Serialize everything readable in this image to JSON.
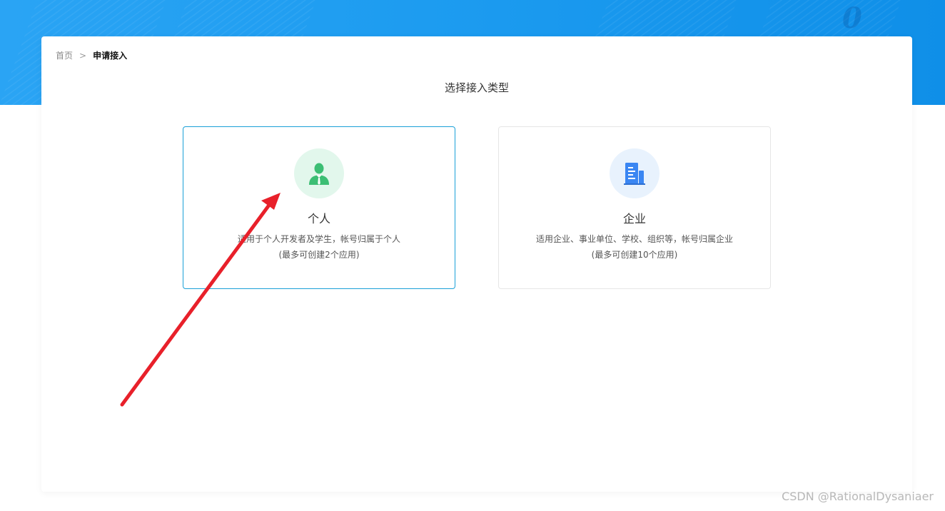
{
  "breadcrumb": {
    "home": "首页",
    "separator": ">",
    "current": "申请接入"
  },
  "page_title": "选择接入类型",
  "access_types": [
    {
      "name": "个人",
      "description": "适用于个人开发者及学生，帐号归属于个人",
      "limit": "(最多可创建2个应用)",
      "icon": "person-icon",
      "selected": true
    },
    {
      "name": "企业",
      "description": "适用企业、事业单位、学校、组织等，帐号归属企业",
      "limit": "(最多可创建10个应用)",
      "icon": "building-icon",
      "selected": false
    }
  ],
  "watermark": "CSDN @RationalDysaniaer",
  "colors": {
    "banner": "#1d9cf0",
    "selected_border": "#1aa0d8",
    "person_icon": "#3cbe74",
    "building_icon": "#3a86f2",
    "annotation_arrow": "#e8202a"
  }
}
